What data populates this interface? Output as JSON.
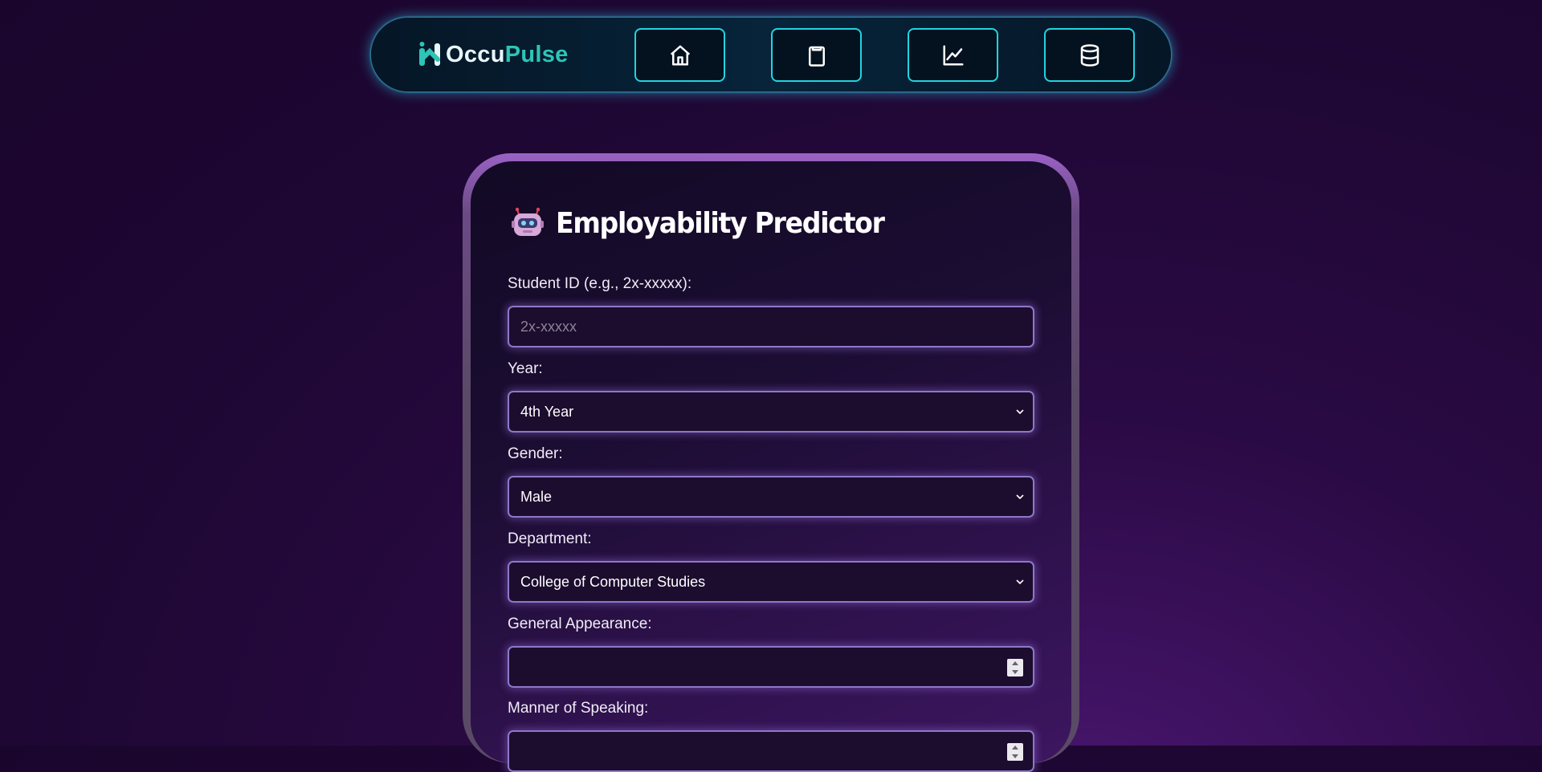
{
  "brand": {
    "name_part1": "Occu",
    "name_part2": "Pulse"
  },
  "nav": {
    "items": [
      {
        "name": "home",
        "icon": "home-icon"
      },
      {
        "name": "clipboard",
        "icon": "clipboard-icon"
      },
      {
        "name": "analytics",
        "icon": "line-chart-icon"
      },
      {
        "name": "database",
        "icon": "database-icon"
      }
    ],
    "accent": "#21d4e0"
  },
  "form": {
    "title": "Employability Predictor",
    "title_icon": "robot-icon",
    "student_id": {
      "label": "Student ID (e.g., 2x-xxxxx):",
      "placeholder": "2x-xxxxx",
      "value": ""
    },
    "year": {
      "label": "Year:",
      "value": "4th Year"
    },
    "gender": {
      "label": "Gender:",
      "value": "Male"
    },
    "department": {
      "label": "Department:",
      "value": "College of Computer Studies"
    },
    "general_appearance": {
      "label": "General Appearance:",
      "value": ""
    },
    "manner_of_speaking": {
      "label": "Manner of Speaking:",
      "value": ""
    }
  }
}
